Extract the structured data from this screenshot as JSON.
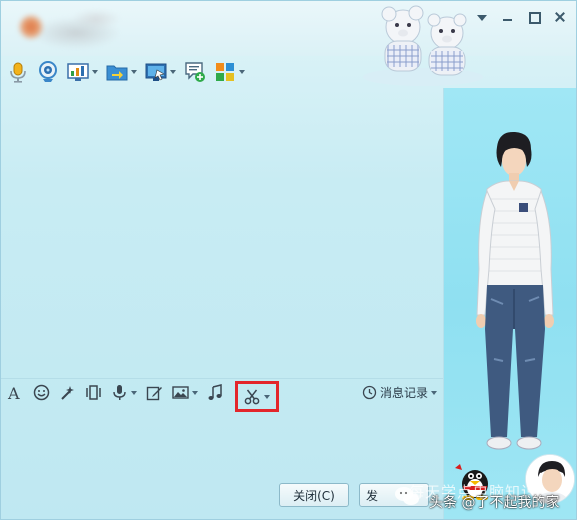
{
  "window": {
    "controls": [
      "menu-triangle",
      "minimize",
      "maximize",
      "close"
    ]
  },
  "toolbar": {
    "items": [
      {
        "name": "voice-call",
        "icon": "microphone-icon",
        "dropdown": false
      },
      {
        "name": "video-call",
        "icon": "webcam-icon",
        "dropdown": false
      },
      {
        "name": "remote-desktop",
        "icon": "chart-screen-icon",
        "dropdown": true
      },
      {
        "name": "send-file",
        "icon": "folder-arrow-icon",
        "dropdown": true
      },
      {
        "name": "screen-share",
        "icon": "monitor-icon",
        "dropdown": true
      },
      {
        "name": "chat-group",
        "icon": "chat-plus-icon",
        "dropdown": false
      },
      {
        "name": "apps",
        "icon": "app-grid-icon",
        "dropdown": true
      }
    ]
  },
  "input_toolbar": {
    "items": [
      "font-icon",
      "emoji-icon",
      "magic-icon",
      "shake-icon",
      "voice-icon",
      "edit-icon",
      "image-icon",
      "music-icon",
      "scissors-icon"
    ],
    "history_label": "消息记录"
  },
  "buttons": {
    "close_label": "关闭(C)",
    "send_label": "发"
  },
  "watermark": {
    "back_text": "每天学点电脑知识",
    "front_text": "头条 @了不起我的家"
  },
  "colors": {
    "right_panel": "#8fe0f1",
    "highlight": "#e3262b"
  }
}
